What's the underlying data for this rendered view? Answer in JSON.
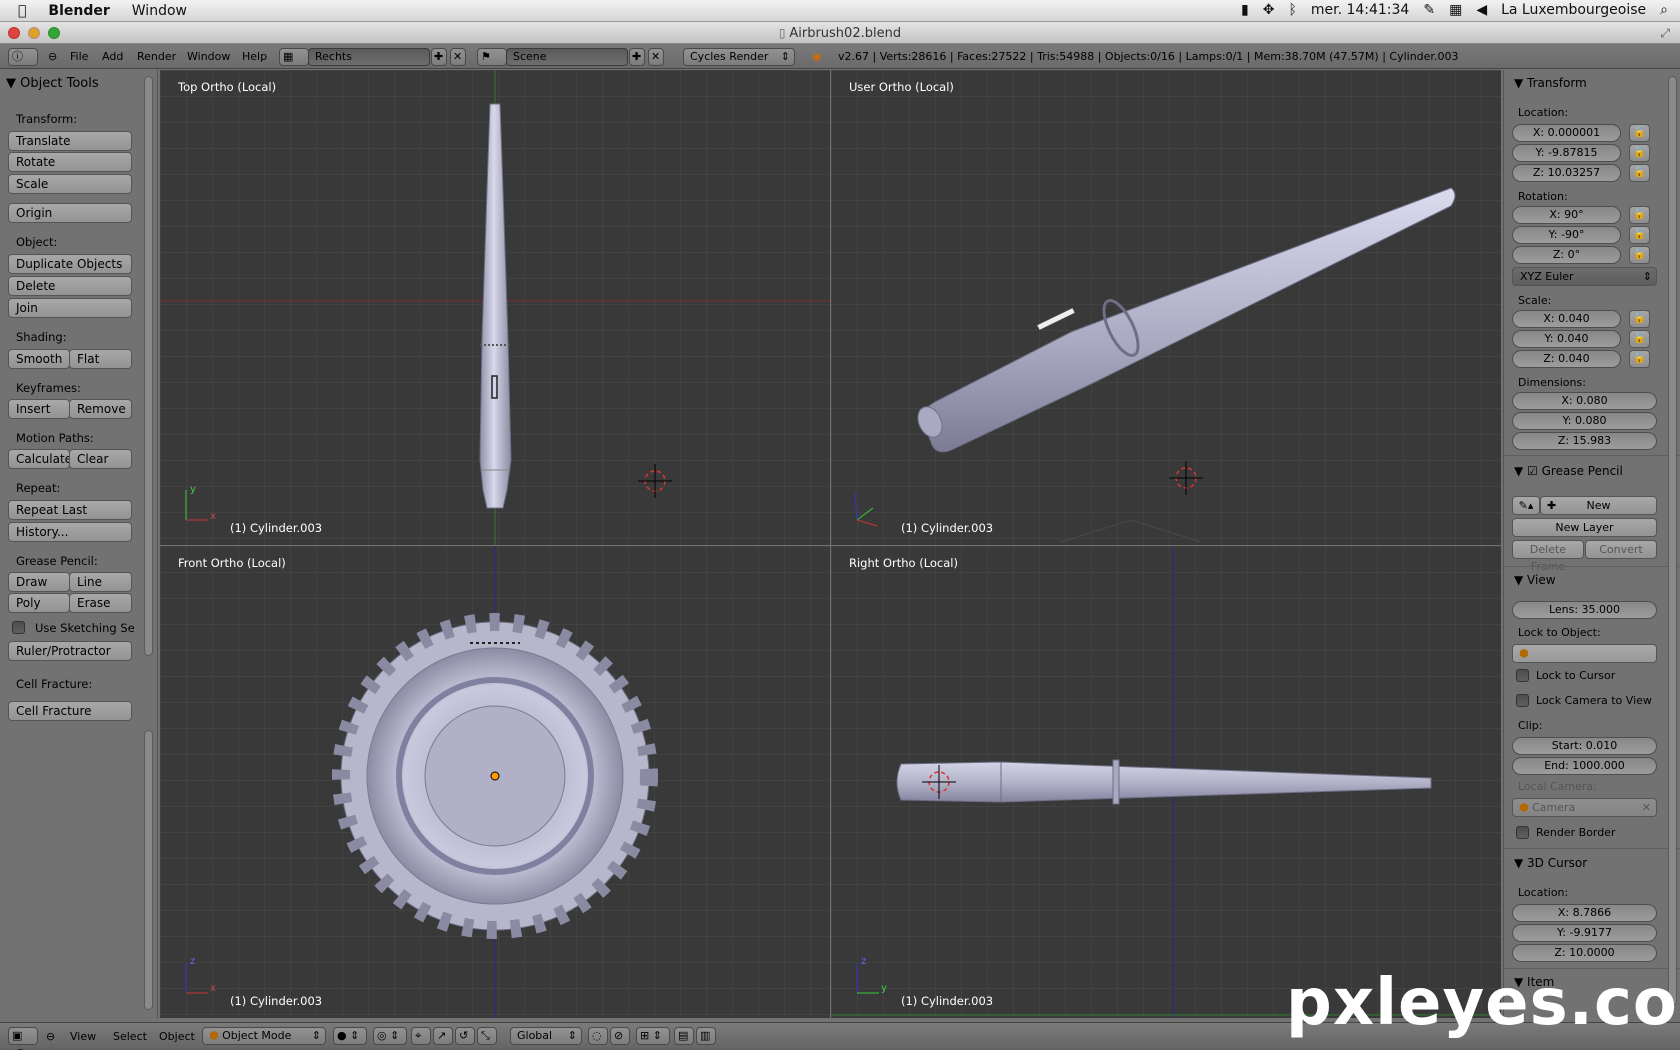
{
  "menubar": {
    "app": "Blender",
    "window_menu": "Window",
    "clock": "mer. 14:41:34",
    "location": "La Luxembourgeoise"
  },
  "window": {
    "title": "Airbrush02.blend"
  },
  "infobar": {
    "menus": [
      "File",
      "Add",
      "Render",
      "Window",
      "Help"
    ],
    "layout": "Rechts",
    "scene": "Scene",
    "engine": "Cycles Render",
    "stats": "v2.67 | Verts:28616 | Faces:27522 | Tris:54988 | Objects:0/16 | Lamps:0/1 | Mem:38.70M (47.57M) | Cylinder.003"
  },
  "toolshelf": {
    "title": "Object Tools",
    "transform_label": "Transform:",
    "translate": "Translate",
    "rotate": "Rotate",
    "scale": "Scale",
    "origin": "Origin",
    "object_label": "Object:",
    "duplicate": "Duplicate Objects",
    "delete": "Delete",
    "join": "Join",
    "shading_label": "Shading:",
    "smooth": "Smooth",
    "flat": "Flat",
    "keyframes_label": "Keyframes:",
    "insert": "Insert",
    "remove": "Remove",
    "motion_label": "Motion Paths:",
    "calculate": "Calculate",
    "clear": "Clear",
    "repeat_label": "Repeat:",
    "repeat_last": "Repeat Last",
    "history": "History...",
    "grease_label": "Grease Pencil:",
    "draw": "Draw",
    "line": "Line",
    "poly": "Poly",
    "erase": "Erase",
    "use_sketching": "Use Sketching Se",
    "ruler": "Ruler/Protractor",
    "cell_label": "Cell Fracture:",
    "cell_fracture": "Cell Fracture"
  },
  "viewports": {
    "top_left": {
      "title": "Top Ortho (Local)",
      "object": "(1) Cylinder.003"
    },
    "top_right": {
      "title": "User Ortho (Local)",
      "object": "(1) Cylinder.003"
    },
    "bottom_left": {
      "title": "Front Ortho (Local)",
      "object": "(1) Cylinder.003"
    },
    "bottom_right": {
      "title": "Right Ortho (Local)",
      "object": "(1) Cylinder.003"
    },
    "axis_x": "x",
    "axis_y": "y",
    "axis_z": "z"
  },
  "properties": {
    "transform_title": "Transform",
    "location_label": "Location:",
    "loc_x": "X: 0.000001",
    "loc_y": "Y: -9.87815",
    "loc_z": "Z: 10.03257",
    "rotation_label": "Rotation:",
    "rot_x": "X: 90°",
    "rot_y": "Y: -90°",
    "rot_z": "Z: 0°",
    "rotation_mode": "XYZ Euler",
    "scale_label": "Scale:",
    "scale_x": "X: 0.040",
    "scale_y": "Y: 0.040",
    "scale_z": "Z: 0.040",
    "dimensions_label": "Dimensions:",
    "dim_x": "X: 0.080",
    "dim_y": "Y: 0.080",
    "dim_z": "Z: 15.983",
    "grease_title": "Grease Pencil",
    "new": "New",
    "new_layer": "New Layer",
    "delete_frame": "Delete Frame",
    "convert": "Convert",
    "view_title": "View",
    "lens": "Lens: 35.000",
    "lock_to_object": "Lock to Object:",
    "lock_to_cursor": "Lock to Cursor",
    "lock_camera": "Lock Camera to View",
    "clip_label": "Clip:",
    "clip_start": "Start: 0.010",
    "clip_end": "End: 1000.000",
    "local_camera": "Local Camera:",
    "camera": "Camera",
    "render_border": "Render Border",
    "cursor_title": "3D Cursor",
    "cursor_location": "Location:",
    "cur_x": "X: 8.7866",
    "cur_y": "Y: -9.9177",
    "cur_z": "Z: 10.0000",
    "item_title": "Item"
  },
  "bottombar": {
    "view": "View",
    "select": "Select",
    "object": "Object",
    "mode": "Object Mode",
    "orientation": "Global"
  },
  "watermark": "pxleyes.com",
  "colors": {
    "viewport_bg": "#393939",
    "panel_bg": "#727272",
    "mesh": "#b4b4cc",
    "x_axis": "#8a2a2a",
    "y_axis": "#2b8a2b",
    "z_axis": "#2a2a8a"
  }
}
